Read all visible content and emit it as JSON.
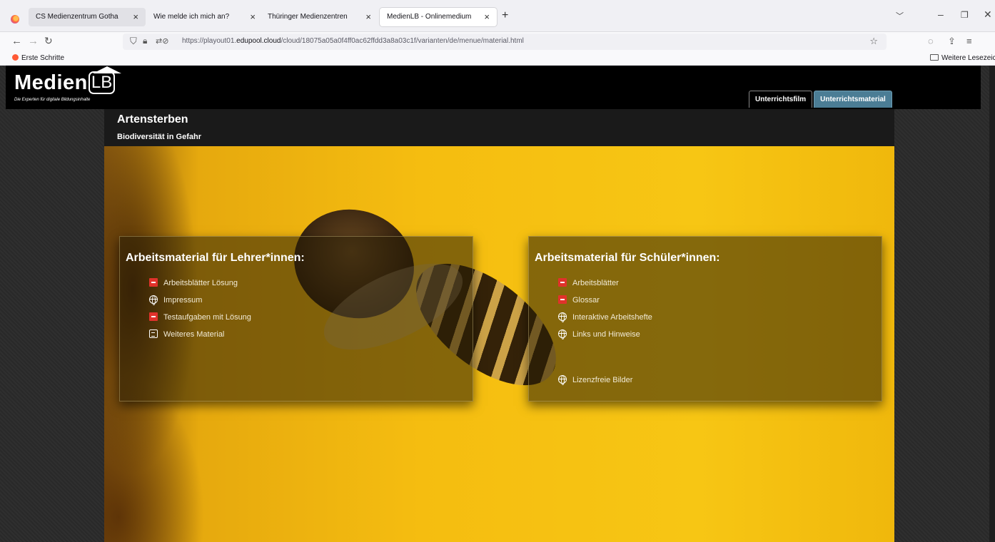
{
  "browser": {
    "tabs": [
      {
        "label": "CS Medienzentrum Gotha"
      },
      {
        "label": "Wie melde ich mich an?"
      },
      {
        "label": "Thüringer Medienzentren"
      },
      {
        "label": "MedienLB - Onlinemedium"
      }
    ],
    "url_prefix": "https://playout01.",
    "url_domain": "edupool.cloud",
    "url_suffix": "/cloud/18075a05a0f4ff0ac62ffdd3a8a03c1f/varianten/de/menue/material.html",
    "bookmark_first": "Erste Schritte",
    "bookmark_other": "Weitere Lesezeichen"
  },
  "header": {
    "logo_word": "Medien",
    "logo_lb": "LB",
    "logo_sub": "Die Experten für digitale Bildungsinhalte",
    "tabs": [
      {
        "label": "Unterrichtsfilm",
        "active": false
      },
      {
        "label": "Unterrichtsmaterial",
        "active": true
      }
    ]
  },
  "title": {
    "main": "Artensterben",
    "sub": "Biodiversität in Gefahr"
  },
  "teacher": {
    "heading": "Arbeitsmaterial für Lehrer*innen:",
    "items": [
      {
        "label": "Arbeitsblätter Lösung",
        "icon": "pdf-icon"
      },
      {
        "label": "Impressum",
        "icon": "globe-icon"
      },
      {
        "label": "Testaufgaben mit Lösung",
        "icon": "pdf-icon"
      },
      {
        "label": "Weiteres Material",
        "icon": "document-icon"
      }
    ]
  },
  "student": {
    "heading": "Arbeitsmaterial für Schüler*innen:",
    "items": [
      {
        "label": "Arbeitsblätter",
        "icon": "pdf-icon"
      },
      {
        "label": "Glossar",
        "icon": "pdf-icon"
      },
      {
        "label": "Interaktive Arbeitshefte",
        "icon": "globe-icon"
      },
      {
        "label": "Links und Hinweise",
        "icon": "globe-icon"
      },
      {
        "label": "Lizenzfreie Bilder",
        "icon": "globe-icon"
      }
    ]
  },
  "colors": {
    "active_tab": "#4b7d95",
    "hero_yellow": "#f5bd10",
    "pdf_red": "#e0322b"
  }
}
